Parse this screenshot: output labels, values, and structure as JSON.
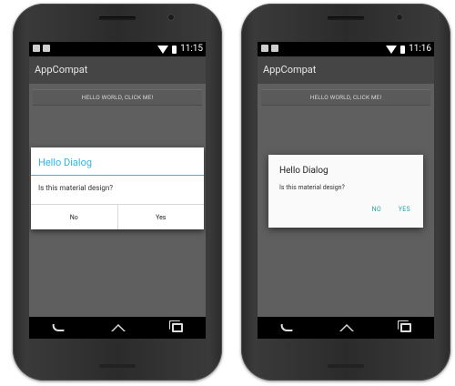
{
  "phones": [
    {
      "status": {
        "time": "11:15"
      },
      "action_bar": {
        "title": "AppCompat"
      },
      "content": {
        "button_label": "HELLO WORLD, CLICK ME!"
      },
      "dialog": {
        "title": "Hello Dialog",
        "message": "Is this material design?",
        "negative": "No",
        "positive": "Yes"
      }
    },
    {
      "status": {
        "time": "11:16"
      },
      "action_bar": {
        "title": "AppCompat"
      },
      "content": {
        "button_label": "HELLO WORLD, CLICK ME!"
      },
      "dialog": {
        "title": "Hello Dialog",
        "message": "Is this material design?",
        "negative": "NO",
        "positive": "YES"
      }
    }
  ],
  "colors": {
    "holo_accent": "#33b5e5",
    "material_accent": "#2aa3a0",
    "screen_bg": "#5f5f5f",
    "action_bar_bg": "#454545"
  },
  "icons": [
    "wifi-icon",
    "battery-icon",
    "back-icon",
    "home-icon",
    "recents-icon"
  ]
}
